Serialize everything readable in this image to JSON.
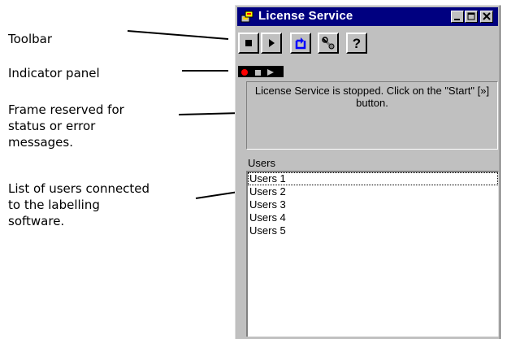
{
  "annotations": {
    "toolbar": "Toolbar",
    "indicator": "Indicator panel",
    "status": "Frame reserved for status or error messages.",
    "users": "List of users connected to the labelling software."
  },
  "window": {
    "title": "License Service",
    "status_message": "License Service is stopped. Click on the \"Start\" [»] button.",
    "users_label": "Users",
    "users": [
      "Users 1",
      "Users 2",
      "Users 3",
      "Users 4",
      "Users 5"
    ]
  },
  "colors": {
    "titlebar": "#000080",
    "face": "#c0c0c0",
    "indicator_red": "#ff0000",
    "toolbar_icon_blue": "#0000ff"
  }
}
